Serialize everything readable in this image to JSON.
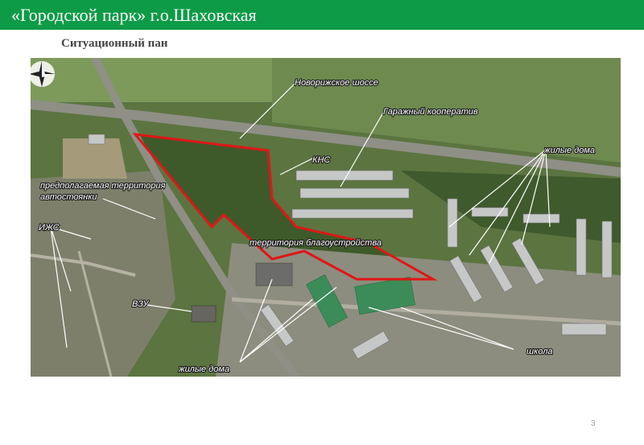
{
  "header": {
    "title": "«Городской парк» г.о.Шаховская"
  },
  "section": {
    "subtitle": "Ситуационный пан"
  },
  "map": {
    "labels": {
      "highway": "Новорижское шоссе",
      "garage": "Гаражный кооператив",
      "kns": "КНС",
      "residential_right": "жилые дома",
      "parking_line1": "предполагаемая территория",
      "parking_line2": "автостоянки",
      "izhs": "ИЖС",
      "improvement": "территория благоустройства",
      "vzu": "ВЗУ",
      "school": "школа",
      "residential_bottom": "жилые дома"
    },
    "colors": {
      "boundary": "#e01616",
      "label_text": "#ffffff",
      "vegetation": "#4f6b35",
      "road": "#8f8f86"
    },
    "icons": {
      "compass": "compass-rose-icon"
    }
  },
  "footer": {
    "page_number": "3"
  }
}
